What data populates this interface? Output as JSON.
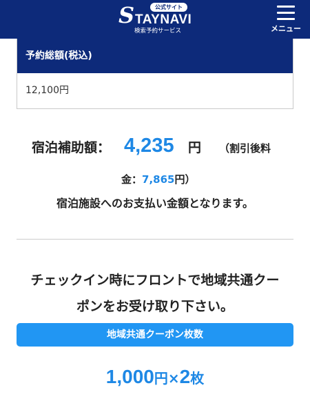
{
  "header": {
    "official_badge": "公式サイト",
    "brand_initial": "S",
    "brand_rest": "TAYNAVI",
    "brand_sub": "検索予約サービス",
    "menu_label": "メニュー"
  },
  "price_table": {
    "header": "予約総額(税込)",
    "value": "12,100円"
  },
  "subsidy": {
    "label": "宿泊補助額：",
    "amount": "4,235",
    "unit": "円",
    "discount_open": "（割引後料",
    "discount_cont": "金：",
    "discount_amount": "7,865",
    "discount_close": "円）",
    "pay_note": "宿泊施設へのお支払い金額となります。"
  },
  "coupon": {
    "message_line1": "チェックイン時にフロントで地域共通クー",
    "message_line2": "ポンをお受け取り下さい。",
    "bar_label": "地域共通クーポン枚数",
    "value_amount": "1,000",
    "value_unit": "円×",
    "value_count": "2",
    "value_count_unit": "枚"
  },
  "colors": {
    "header_bg": "#0d2a7a",
    "accent_blue": "#1e88e5",
    "button_blue": "#2196f3"
  }
}
